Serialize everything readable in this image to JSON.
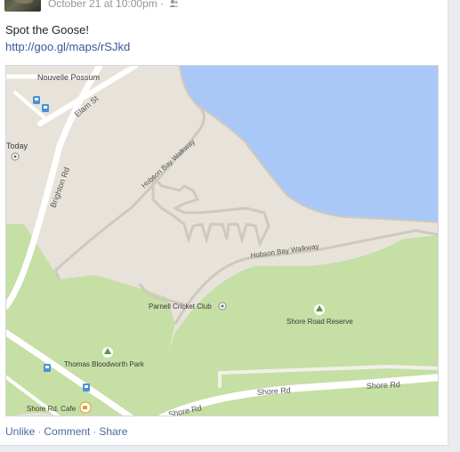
{
  "post": {
    "timestamp": "October 21 at 10:00pm",
    "separator": "·",
    "audience_icon": "friends-icon",
    "text": "Spot the Goose!",
    "link": "http://goo.gl/maps/rSJkd"
  },
  "map": {
    "labels": {
      "nouvelle_possum": "Nouvelle Possum",
      "elam_st": "Elam St",
      "today": "Today",
      "brighton_rd": "Brighton Rd",
      "hobson_bay_walkway_1": "Hobson Bay Walkway",
      "hobson_bay_walkway_2": "Hobson Bay Walkway",
      "parnell_cricket_club": "Parnell Cricket Club",
      "shore_road_reserve": "Shore Road Reserve",
      "thomas_bloodworth_park": "Thomas Bloodworth Park",
      "shore_rd_1": "Shore Rd",
      "shore_rd_2": "Shore Rd",
      "shore_rd_3": "Shore Rd",
      "shore_rd_cafe": "Shore Rd. Cafe"
    },
    "colors": {
      "land": "#e7e3db",
      "water": "#a9c8f7",
      "park": "#c5dfa4",
      "road": "#ffffff"
    }
  },
  "actions": {
    "unlike": "Unlike",
    "comment": "Comment",
    "share": "Share",
    "separator": "·"
  }
}
